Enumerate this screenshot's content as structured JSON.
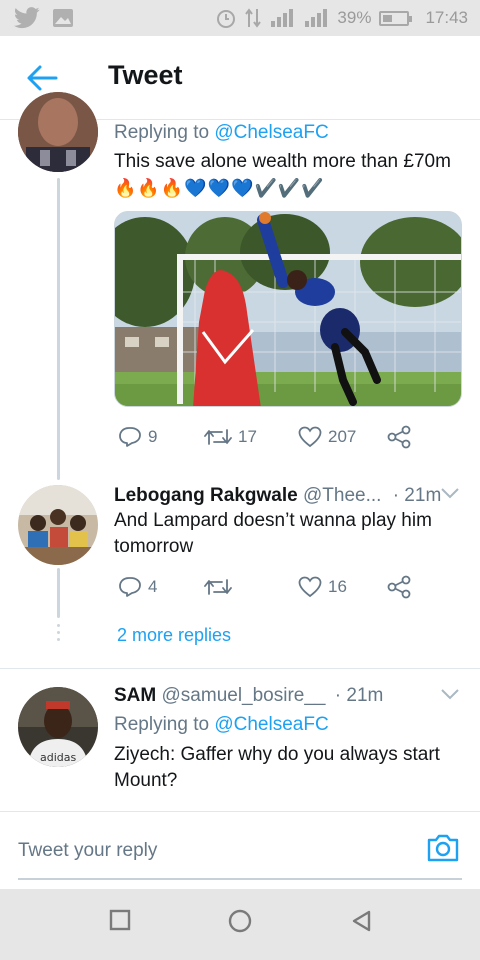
{
  "status_bar": {
    "battery_text": "39%",
    "time": "17:43",
    "battery_level": 0.39,
    "icons": [
      "twitter-icon",
      "image-icon",
      "alarm-icon",
      "data-transfer-icon",
      "signal-icon",
      "signal-icon",
      "battery-icon"
    ]
  },
  "header": {
    "title": "Tweet",
    "back_icon": "arrow-left-icon"
  },
  "tweet1": {
    "replying_prefix": "Replying to",
    "replying_handle": "@ChelseaFC",
    "body": "This save alone wealth more than £70m",
    "emojis": "🔥🔥🔥💙💙💙✔️✔️✔️",
    "media_description": "goalkeeper diving save",
    "stats": {
      "replies": "9",
      "retweets": "17",
      "likes": "207"
    }
  },
  "tweet2": {
    "name": "Lebogang Rakgwale",
    "handle": "@Thee...",
    "time": "· 21m",
    "body_line1": "And Lampard doesn’t wanna play him",
    "body_line2": "tomorrow",
    "stats": {
      "replies": "4",
      "retweets": "",
      "likes": "16"
    }
  },
  "more_replies": "2 more replies",
  "tweet3": {
    "name": "SAM",
    "handle": "@samuel_bosire__",
    "time": "· 21m",
    "replying_prefix": "Replying to",
    "replying_handle": "@ChelseaFC",
    "body_line1": "Ziyech: Gaffer why do you always start",
    "body_line2": "Mount?"
  },
  "reply_bar": {
    "placeholder": "Tweet your reply",
    "camera_icon": "camera-icon"
  },
  "colors": {
    "accent": "#1da1f2",
    "muted": "#657786",
    "divider": "#e1e8ed"
  }
}
